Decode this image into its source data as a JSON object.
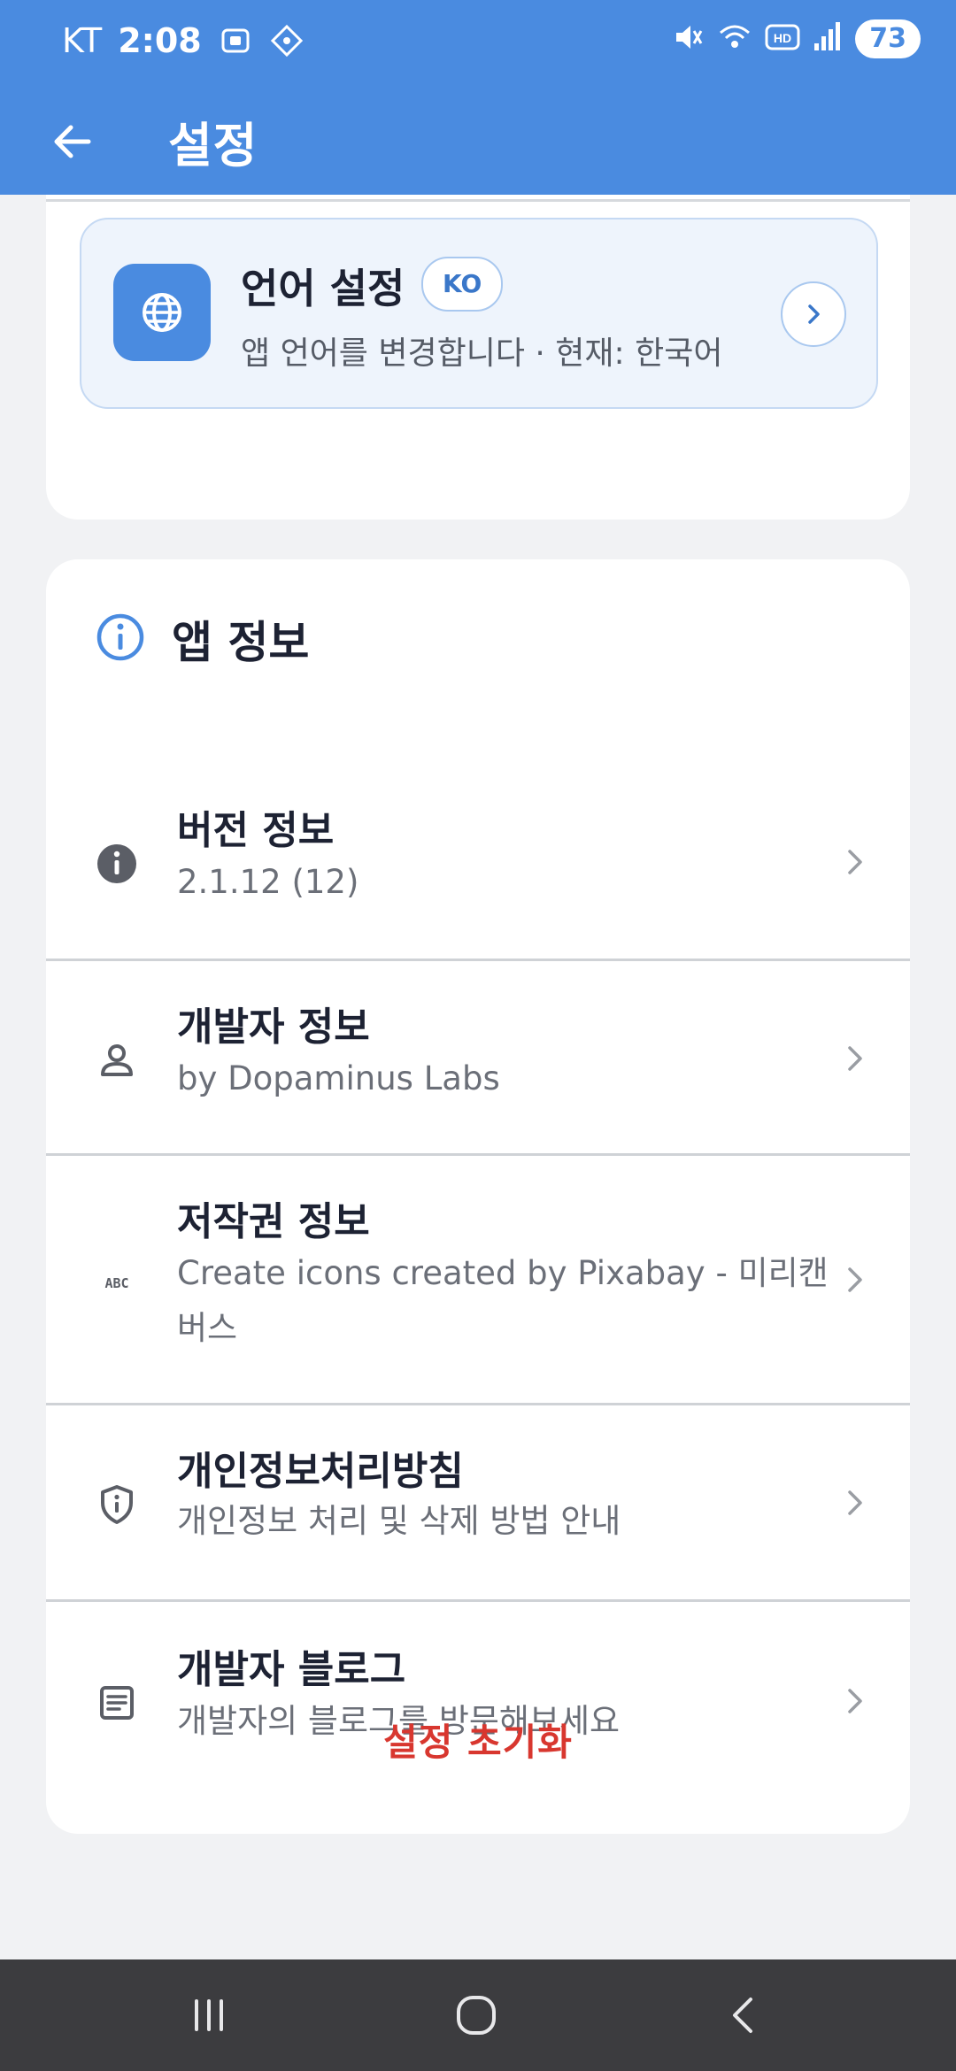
{
  "status_bar": {
    "carrier": "KT",
    "time": "2:08",
    "battery": "73"
  },
  "header": {
    "title": "설정"
  },
  "language_card": {
    "title": "언어 설정",
    "badge": "KO",
    "subtitle": "앱 언어를 변경합니다 · 현재: 한국어"
  },
  "app_info": {
    "section_title": "앱 정보",
    "items": [
      {
        "icon": "info-filled-icon",
        "title": "버전 정보",
        "subtitle": "2.1.12 (12)"
      },
      {
        "icon": "person-icon",
        "title": "개발자 정보",
        "subtitle": "by Dopaminus Labs"
      },
      {
        "icon": "abc-icon",
        "title": "저작권 정보",
        "subtitle": "Create icons created by Pixabay - 미리캔버스"
      },
      {
        "icon": "shield-info-icon",
        "title": "개인정보처리방침",
        "subtitle": "개인정보 처리 및 삭제 방법 안내"
      },
      {
        "icon": "article-icon",
        "title": "개발자 블로그",
        "subtitle": "개발자의 블로그를 방문해보세요"
      }
    ]
  },
  "footer": {
    "reset_label": "설정 초기화"
  },
  "colors": {
    "primary": "#4a8be0",
    "danger": "#d8372f",
    "background": "#f1f2f4",
    "navbar": "#3c3c3f"
  }
}
